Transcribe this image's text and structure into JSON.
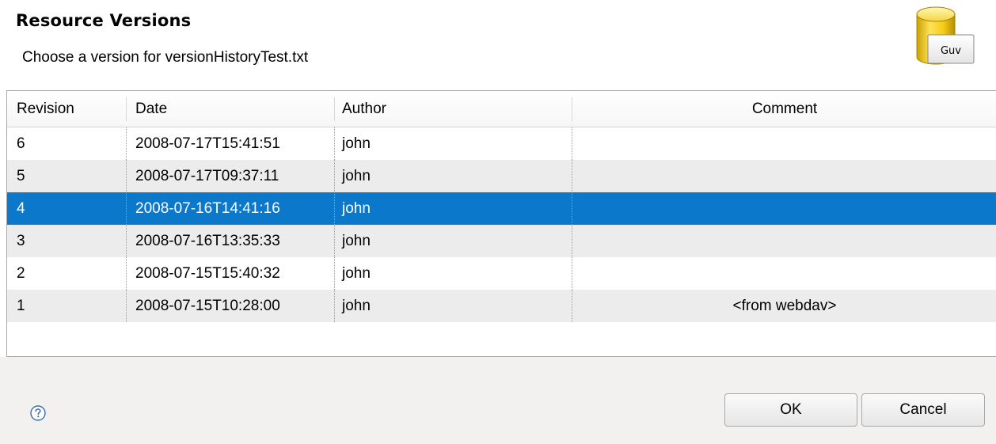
{
  "dialog": {
    "title": "Resource Versions",
    "subtitle": "Choose a version for versionHistoryTest.txt",
    "banner_icon": {
      "name": "repository-icon",
      "label": "Guv"
    }
  },
  "table": {
    "columns": [
      {
        "label": "Revision"
      },
      {
        "label": "Date"
      },
      {
        "label": "Author"
      },
      {
        "label": "Comment"
      }
    ],
    "selected_revision": "4",
    "rows": [
      {
        "revision": "6",
        "date": "2008-07-17T15:41:51",
        "author": "john",
        "comment": ""
      },
      {
        "revision": "5",
        "date": "2008-07-17T09:37:11",
        "author": "john",
        "comment": ""
      },
      {
        "revision": "4",
        "date": "2008-07-16T14:41:16",
        "author": "john",
        "comment": ""
      },
      {
        "revision": "3",
        "date": "2008-07-16T13:35:33",
        "author": "john",
        "comment": ""
      },
      {
        "revision": "2",
        "date": "2008-07-15T15:40:32",
        "author": "john",
        "comment": ""
      },
      {
        "revision": "1",
        "date": "2008-07-15T10:28:00",
        "author": "john",
        "comment": "<from webdav>"
      }
    ]
  },
  "footer": {
    "help_icon": "help-icon",
    "ok_label": "OK",
    "cancel_label": "Cancel"
  },
  "colors": {
    "selection": "#0c78cc",
    "alt_row": "#ececec",
    "footer_bg": "#f2f1f0"
  }
}
